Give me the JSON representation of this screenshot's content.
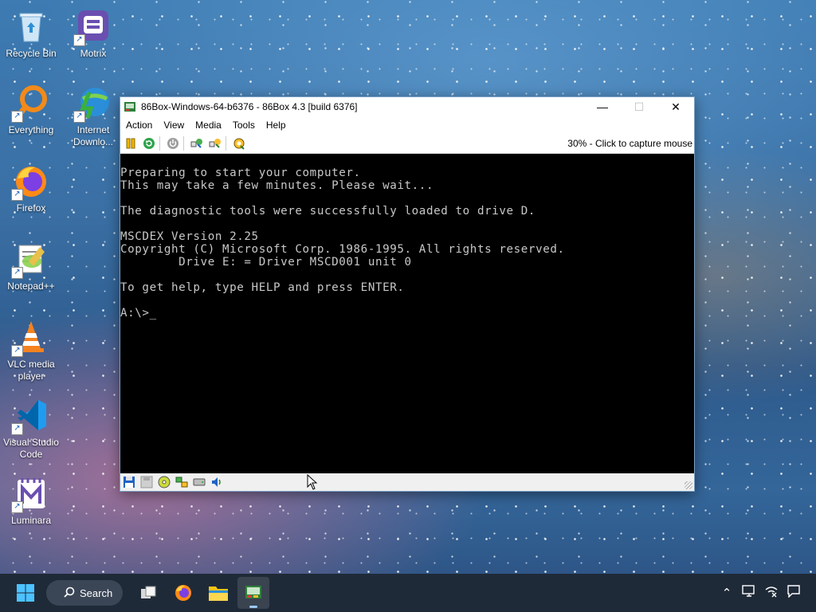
{
  "desktop": {
    "icons": [
      {
        "label": "Recycle Bin"
      },
      {
        "label": "Motrix"
      },
      {
        "label": "Everything"
      },
      {
        "label": "Internet Downlo..."
      },
      {
        "label": "Firefox"
      },
      {
        "label": "Notepad++"
      },
      {
        "label": "VLC media player"
      },
      {
        "label": "Visual Studio Code"
      },
      {
        "label": "Luminara"
      }
    ]
  },
  "window": {
    "title": "86Box-Windows-64-b6376 - 86Box 4.3 [build 6376]",
    "controls": {
      "minimize": "—",
      "maximize": "☐",
      "close": "✕"
    },
    "menu": [
      "Action",
      "View",
      "Media",
      "Tools",
      "Help"
    ],
    "capture_status": "30% - Click to capture mouse",
    "console_lines": [
      "Preparing to start your computer.",
      "This may take a few minutes. Please wait...",
      "",
      "The diagnostic tools were successfully loaded to drive D.",
      "",
      "MSCDEX Version 2.25",
      "Copyright (C) Microsoft Corp. 1986-1995. All rights reserved.",
      "        Drive E: = Driver MSCD001 unit 0",
      "",
      "To get help, type HELP and press ENTER.",
      "",
      "A:\\>_"
    ]
  },
  "taskbar": {
    "search_label": "Search"
  },
  "colors": {
    "accent": "#0078d4",
    "console_bg": "#000000",
    "console_fg": "#c8c8c8",
    "taskbar_bg": "#1f2a38"
  }
}
